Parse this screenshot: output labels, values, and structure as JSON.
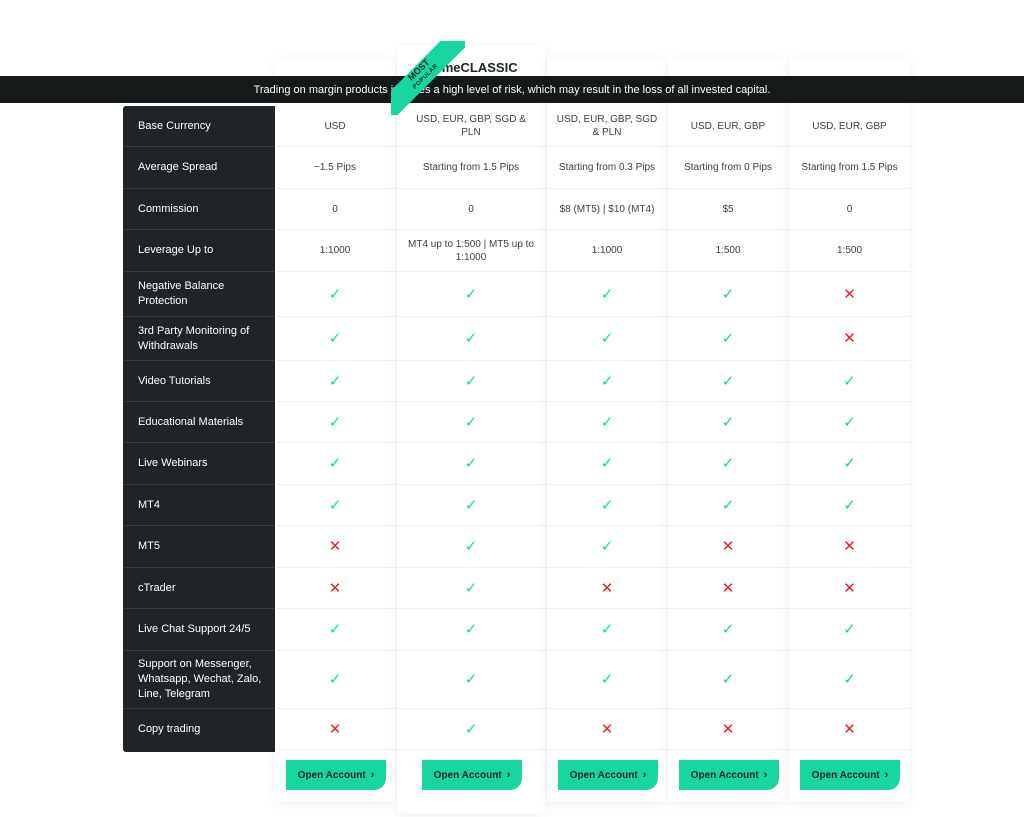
{
  "risk_banner": "Trading on margin products involves a high level of risk, which may result in the loss of all invested capital.",
  "ribbon": {
    "line1": "MOST",
    "line2": "POPULAR"
  },
  "accounts": [
    {
      "title": "",
      "button": "Open Account"
    },
    {
      "title": "PrimeCLASSIC",
      "button": "Open Account"
    },
    {
      "title": "",
      "button": "Open Account"
    },
    {
      "title": "",
      "button": "Open Account"
    },
    {
      "title": "",
      "button": "Open Account"
    }
  ],
  "features": [
    {
      "label": "Base Currency",
      "values": [
        "USD",
        "USD, EUR, GBP, SGD & PLN",
        "USD, EUR, GBP, SGD & PLN",
        "USD, EUR, GBP",
        "USD, EUR, GBP"
      ]
    },
    {
      "label": "Average Spread",
      "values": [
        "~1.5 Pips",
        "Starting from 1.5 Pips",
        "Starting from 0.3 Pips",
        "Starting from 0 Pips",
        "Starting from 1.5 Pips"
      ]
    },
    {
      "label": "Commission",
      "values": [
        "0",
        "0",
        "$8 (MT5) | $10 (MT4)",
        "$5",
        "0"
      ]
    },
    {
      "label": "Leverage Up to",
      "values": [
        "1:1000",
        "MT4 up to 1:500 | MT5 up to 1:1000",
        "1:1000",
        "1:500",
        "1:500"
      ]
    },
    {
      "label": "Negative Balance Protection",
      "values": [
        true,
        true,
        true,
        true,
        false
      ]
    },
    {
      "label": "3rd Party Monitoring of Withdrawals",
      "values": [
        true,
        true,
        true,
        true,
        false
      ]
    },
    {
      "label": "Video Tutorials",
      "values": [
        true,
        true,
        true,
        true,
        true
      ]
    },
    {
      "label": "Educational Materials",
      "values": [
        true,
        true,
        true,
        true,
        true
      ]
    },
    {
      "label": "Live Webinars",
      "values": [
        true,
        true,
        true,
        true,
        true
      ]
    },
    {
      "label": "MT4",
      "values": [
        true,
        true,
        true,
        true,
        true
      ]
    },
    {
      "label": "MT5",
      "values": [
        false,
        true,
        true,
        false,
        false
      ]
    },
    {
      "label": "cTrader",
      "values": [
        false,
        true,
        false,
        false,
        false
      ]
    },
    {
      "label": "Live Chat Support 24/5",
      "values": [
        true,
        true,
        true,
        true,
        true
      ]
    },
    {
      "label": "Support on Messenger, Whatsapp, Wechat, Zalo, Line, Telegram",
      "values": [
        true,
        true,
        true,
        true,
        true
      ]
    },
    {
      "label": "Copy trading",
      "values": [
        false,
        true,
        false,
        false,
        false
      ]
    }
  ],
  "icons": {
    "yes": "check-icon",
    "no": "cross-icon",
    "chevron": "chevron-right-icon"
  },
  "colors": {
    "accent": "#17d6a0",
    "negative": "#e4222f",
    "label_panel": "#1f2426",
    "banner": "#16191a"
  }
}
